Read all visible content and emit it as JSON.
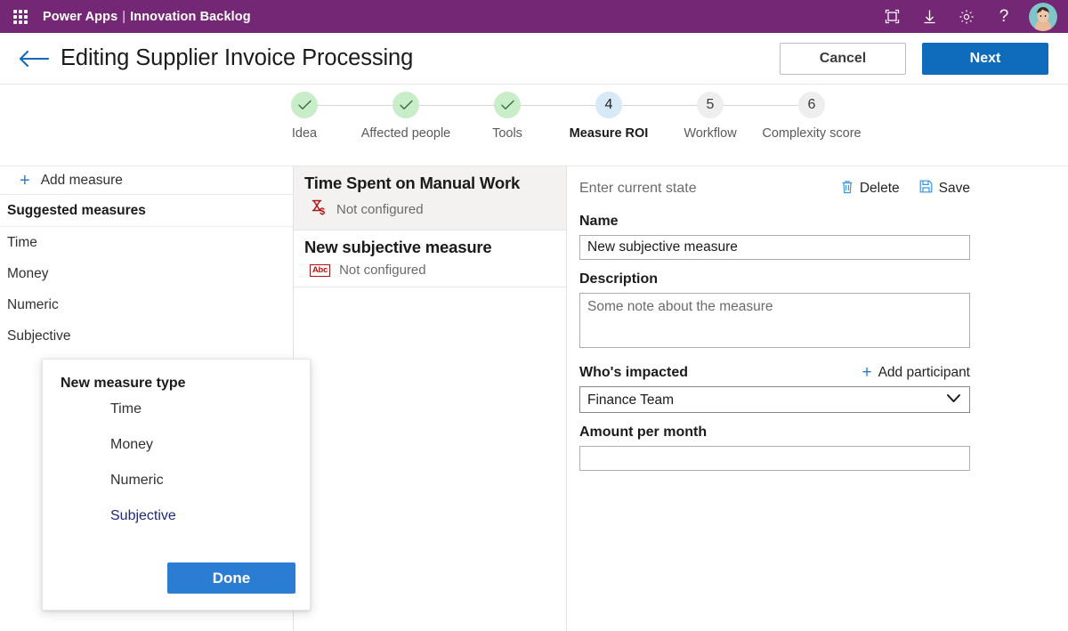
{
  "suite_bar": {
    "waffle_icon": "waffle-grid-icon",
    "brand": "Power Apps",
    "separator": "|",
    "app_name": "Innovation Backlog",
    "actions": [
      {
        "icon": "fullscreen-icon",
        "name": "fullscreen-button"
      },
      {
        "icon": "download-icon",
        "name": "download-button"
      },
      {
        "icon": "gear-icon",
        "name": "settings-button"
      },
      {
        "icon": "help-icon",
        "label": "?",
        "name": "help-button"
      }
    ],
    "avatar": "user-avatar"
  },
  "command_bar": {
    "back_icon": "back-arrow-icon",
    "title": "Editing Supplier Invoice Processing",
    "cancel_label": "Cancel",
    "next_label": "Next",
    "next_color": "#0f6cbd"
  },
  "stepper": {
    "steps": [
      {
        "number": "1",
        "label": "Idea",
        "state": "done",
        "glyph": "✓"
      },
      {
        "number": "2",
        "label": "Affected\npeople",
        "state": "done",
        "glyph": "✓"
      },
      {
        "number": "3",
        "label": "Tools",
        "state": "done",
        "glyph": "✓"
      },
      {
        "number": "4",
        "label": "Measure\nROI",
        "state": "active",
        "glyph": "4"
      },
      {
        "number": "5",
        "label": "Workflow",
        "state": "todo",
        "glyph": "5"
      },
      {
        "number": "6",
        "label": "Complexity\nscore",
        "state": "todo",
        "glyph": "6"
      }
    ],
    "done_color": "#c9ecc9",
    "active_color": "#d7e8f7",
    "todo_color": "#eeeeee"
  },
  "left_panel": {
    "add_measure_label": "Add measure",
    "add_icon": "plus-icon",
    "suggested_header": "Suggested measures",
    "items": [
      {
        "label": "Time"
      },
      {
        "label": "Money"
      },
      {
        "label": "Numeric"
      },
      {
        "label": "Subjective"
      }
    ]
  },
  "measure_list": {
    "cards": [
      {
        "title": "Time Spent on Manual Work",
        "status": "Not configured",
        "icon": "hourglass-money-icon",
        "selected": true
      },
      {
        "title": "New subjective measure",
        "status": "Not configured",
        "icon": "abc-icon",
        "icon_text": "Abc",
        "selected": false
      }
    ]
  },
  "detail_panel": {
    "header_title": "Enter current state",
    "delete_label": "Delete",
    "delete_icon": "trash-icon",
    "save_label": "Save",
    "save_icon": "floppy-disk-icon",
    "name_label": "Name",
    "name_value": "New subjective measure",
    "description_label": "Description",
    "description_value": "",
    "description_placeholder": "Some note about the measure",
    "impacted_label": "Who's impacted",
    "add_participant_label": "Add participant",
    "add_participant_icon": "plus-icon",
    "impacted_value": "Finance Team",
    "impacted_options": [
      "Finance Team"
    ],
    "impacted_chevron": "chevron-down-icon",
    "amount_label": "Amount per month",
    "amount_value": ""
  },
  "flyout": {
    "title": "New measure type",
    "options": [
      {
        "label": "Time",
        "selected": false
      },
      {
        "label": "Money",
        "selected": false
      },
      {
        "label": "Numeric",
        "selected": false
      },
      {
        "label": "Subjective",
        "selected": true
      }
    ],
    "done_label": "Done",
    "done_color": "#2b7cd3"
  }
}
